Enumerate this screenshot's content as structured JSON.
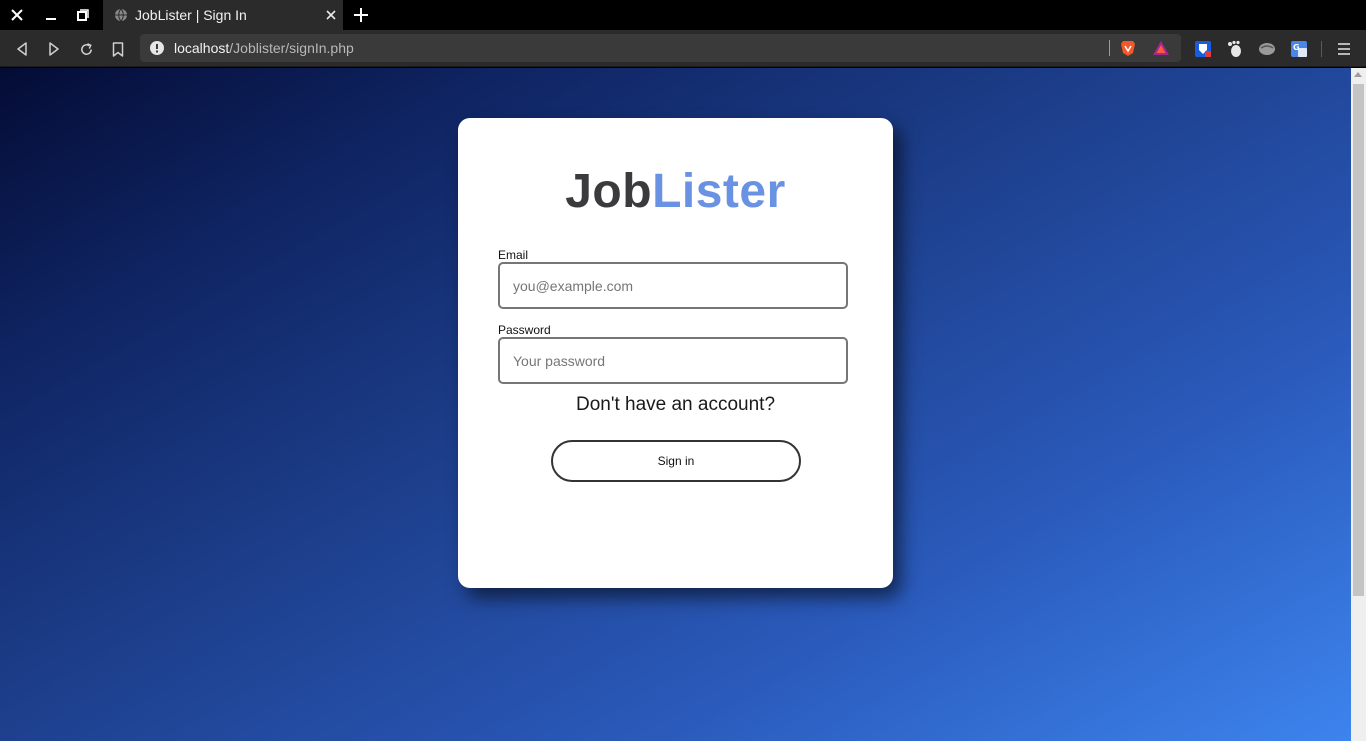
{
  "browser": {
    "tab": {
      "title": "JobLister | Sign In"
    },
    "address": {
      "host": "localhost",
      "path": "/Joblister/signIn.php"
    },
    "icons": {
      "window_close": "close-icon",
      "minimize": "minimize-icon",
      "maximize": "restore-icon",
      "new_tab": "plus-icon",
      "back": "back-icon",
      "forward": "forward-icon",
      "reload": "reload-icon",
      "bookmark": "bookmark-icon",
      "site_info": "info-icon",
      "menu": "hamburger-menu-icon"
    },
    "extensions": [
      "brave-shield-icon",
      "brave-rewards-icon",
      "bitwarden-icon",
      "gnome-icon",
      "extension-icon",
      "translate-icon"
    ]
  },
  "page": {
    "logo": {
      "part1": "Job",
      "part2": "Lister"
    },
    "email": {
      "label": "Email",
      "placeholder": "you@example.com",
      "value": ""
    },
    "password": {
      "label": "Password",
      "placeholder": "Your password",
      "value": ""
    },
    "signup_link": "Don't have an account?",
    "signin_button": "Sign in"
  },
  "colors": {
    "logo_dark": "#3b3b3d",
    "logo_accent": "#6a92e3",
    "bg_gradient_start": "#040c35",
    "bg_gradient_end": "#3d84ee"
  }
}
